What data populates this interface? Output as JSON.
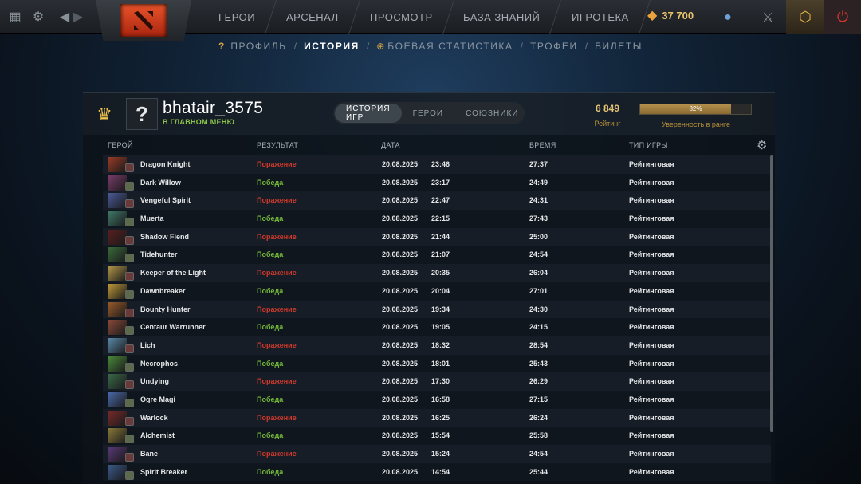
{
  "topbar": {
    "nav": [
      "ГЕРОИ",
      "АРСЕНАЛ",
      "ПРОСМОТР",
      "БАЗА ЗНАНИЙ",
      "ИГРОТЕКА"
    ],
    "currency_value": "37 700"
  },
  "subnav": {
    "items": [
      "ПРОФИЛЬ",
      "ИСТОРИЯ",
      "БОЕВАЯ СТАТИСТИКА",
      "ТРОФЕИ",
      "БИЛЕТЫ"
    ],
    "active": "ИСТОРИЯ"
  },
  "profile": {
    "avatar_text": "?",
    "username": "bhatair_3575",
    "status": "В ГЛАВНОМ МЕНЮ",
    "tabs": [
      "ИСТОРИЯ ИГР",
      "ГЕРОИ",
      "СОЮЗНИКИ"
    ],
    "active_tab": "ИСТОРИЯ ИГР",
    "rating_value": "6 849",
    "rating_label": "Рейтинг",
    "confidence_pct": "82%",
    "confidence_fraction": 0.82,
    "confidence_label": "Уверенность в ранге"
  },
  "table": {
    "headers": [
      "ГЕРОЙ",
      "РЕЗУЛЬТАТ",
      "ДАТА",
      "ВРЕМЯ",
      "ТИП ИГРЫ"
    ],
    "rows": [
      {
        "hero": "Dragon Knight",
        "result": "Поражение",
        "win": false,
        "date": "20.08.2025",
        "time": "23:46",
        "duration": "27:37",
        "type": "Рейтинговая",
        "color": "#9a3b26"
      },
      {
        "hero": "Dark Willow",
        "result": "Победа",
        "win": true,
        "date": "20.08.2025",
        "time": "23:17",
        "duration": "24:49",
        "type": "Рейтинговая",
        "color": "#7a3c6a"
      },
      {
        "hero": "Vengeful Spirit",
        "result": "Поражение",
        "win": false,
        "date": "20.08.2025",
        "time": "22:47",
        "duration": "24:31",
        "type": "Рейтинговая",
        "color": "#4a5b9a"
      },
      {
        "hero": "Muerta",
        "result": "Победа",
        "win": true,
        "date": "20.08.2025",
        "time": "22:15",
        "duration": "27:43",
        "type": "Рейтинговая",
        "color": "#3f7a6a"
      },
      {
        "hero": "Shadow Fiend",
        "result": "Поражение",
        "win": false,
        "date": "20.08.2025",
        "time": "21:44",
        "duration": "25:00",
        "type": "Рейтинговая",
        "color": "#5a1f1f"
      },
      {
        "hero": "Tidehunter",
        "result": "Победа",
        "win": true,
        "date": "20.08.2025",
        "time": "21:07",
        "duration": "24:54",
        "type": "Рейтинговая",
        "color": "#3a6a3a"
      },
      {
        "hero": "Keeper of the Light",
        "result": "Поражение",
        "win": false,
        "date": "20.08.2025",
        "time": "20:35",
        "duration": "26:04",
        "type": "Рейтинговая",
        "color": "#b89a4a"
      },
      {
        "hero": "Dawnbreaker",
        "result": "Победа",
        "win": true,
        "date": "20.08.2025",
        "time": "20:04",
        "duration": "27:01",
        "type": "Рейтинговая",
        "color": "#c09a3a"
      },
      {
        "hero": "Bounty Hunter",
        "result": "Поражение",
        "win": false,
        "date": "20.08.2025",
        "time": "19:34",
        "duration": "24:30",
        "type": "Рейтинговая",
        "color": "#9a5a2a"
      },
      {
        "hero": "Centaur Warrunner",
        "result": "Победа",
        "win": true,
        "date": "20.08.2025",
        "time": "19:05",
        "duration": "24:15",
        "type": "Рейтинговая",
        "color": "#8a4a3a"
      },
      {
        "hero": "Lich",
        "result": "Поражение",
        "win": false,
        "date": "20.08.2025",
        "time": "18:32",
        "duration": "28:54",
        "type": "Рейтинговая",
        "color": "#5a8aaa"
      },
      {
        "hero": "Necrophos",
        "result": "Победа",
        "win": true,
        "date": "20.08.2025",
        "time": "18:01",
        "duration": "25:43",
        "type": "Рейтинговая",
        "color": "#4a8a3a"
      },
      {
        "hero": "Undying",
        "result": "Поражение",
        "win": false,
        "date": "20.08.2025",
        "time": "17:30",
        "duration": "26:29",
        "type": "Рейтинговая",
        "color": "#3a6a4a"
      },
      {
        "hero": "Ogre Magi",
        "result": "Победа",
        "win": true,
        "date": "20.08.2025",
        "time": "16:58",
        "duration": "27:15",
        "type": "Рейтинговая",
        "color": "#4a6aaa"
      },
      {
        "hero": "Warlock",
        "result": "Поражение",
        "win": false,
        "date": "20.08.2025",
        "time": "16:25",
        "duration": "26:24",
        "type": "Рейтинговая",
        "color": "#7a2a2a"
      },
      {
        "hero": "Alchemist",
        "result": "Победа",
        "win": true,
        "date": "20.08.2025",
        "time": "15:54",
        "duration": "25:58",
        "type": "Рейтинговая",
        "color": "#8a7a3a"
      },
      {
        "hero": "Bane",
        "result": "Поражение",
        "win": false,
        "date": "20.08.2025",
        "time": "15:24",
        "duration": "24:54",
        "type": "Рейтинговая",
        "color": "#5a3a7a"
      },
      {
        "hero": "Spirit Breaker",
        "result": "Победа",
        "win": true,
        "date": "20.08.2025",
        "time": "14:54",
        "duration": "25:44",
        "type": "Рейтинговая",
        "color": "#3a5a8a"
      }
    ]
  },
  "icons": {
    "topleft": [
      "stats-icon",
      "settings-gear-icon",
      "back-arrow-icon",
      "forward-arrow-icon"
    ],
    "logo": "dota-logo-icon",
    "right": [
      "currency-shards-icon",
      "chat-icon",
      "armory-icon",
      "plus-icon",
      "power-icon"
    ]
  }
}
